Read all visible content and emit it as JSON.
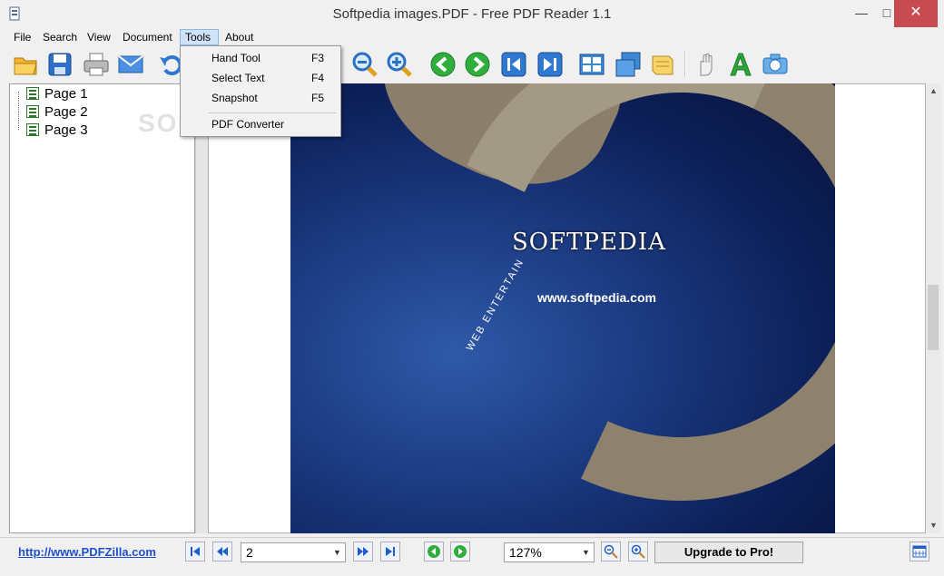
{
  "window": {
    "title": "Softpedia images.PDF - Free PDF Reader 1.1",
    "minimize": "—",
    "maximize": "□",
    "close": "✕"
  },
  "menu": [
    "File",
    "Search",
    "View",
    "Document",
    "Tools",
    "About"
  ],
  "tools_menu": {
    "items": [
      {
        "label": "Hand Tool",
        "shortcut": "F3"
      },
      {
        "label": "Select Text",
        "shortcut": "F4"
      },
      {
        "label": "Snapshot",
        "shortcut": "F5"
      },
      {
        "label": "PDF Converter",
        "shortcut": ""
      }
    ]
  },
  "toolbar": {
    "icons": [
      "open-folder-icon",
      "save-icon",
      "print-icon",
      "email-icon",
      "undo-icon",
      "zoom-out-icon",
      "zoom-in-icon",
      "previous-page-icon",
      "next-page-icon",
      "first-page-icon",
      "last-page-icon",
      "single-page-icon",
      "continuous-page-icon",
      "rotate-icon",
      "hand-tool-icon",
      "select-text-icon",
      "snapshot-icon"
    ]
  },
  "tree": {
    "pages": [
      "Page 1",
      "Page 2",
      "Page 3"
    ]
  },
  "document": {
    "image_text": "SOFTPEDIA",
    "image_url": "www.softpedia.com",
    "image_arc_text": "WEB ENTERTAIN"
  },
  "watermark": "SOFTPEDIA",
  "statusbar": {
    "link": "http://www.PDFZilla.com",
    "page_value": "2",
    "zoom_value": "127%",
    "upgrade_label": "Upgrade to Pro!"
  },
  "colors": {
    "accent": "#1f4fcf",
    "close_button": "#c74b50",
    "menu_highlight": "#cfe2f7"
  }
}
